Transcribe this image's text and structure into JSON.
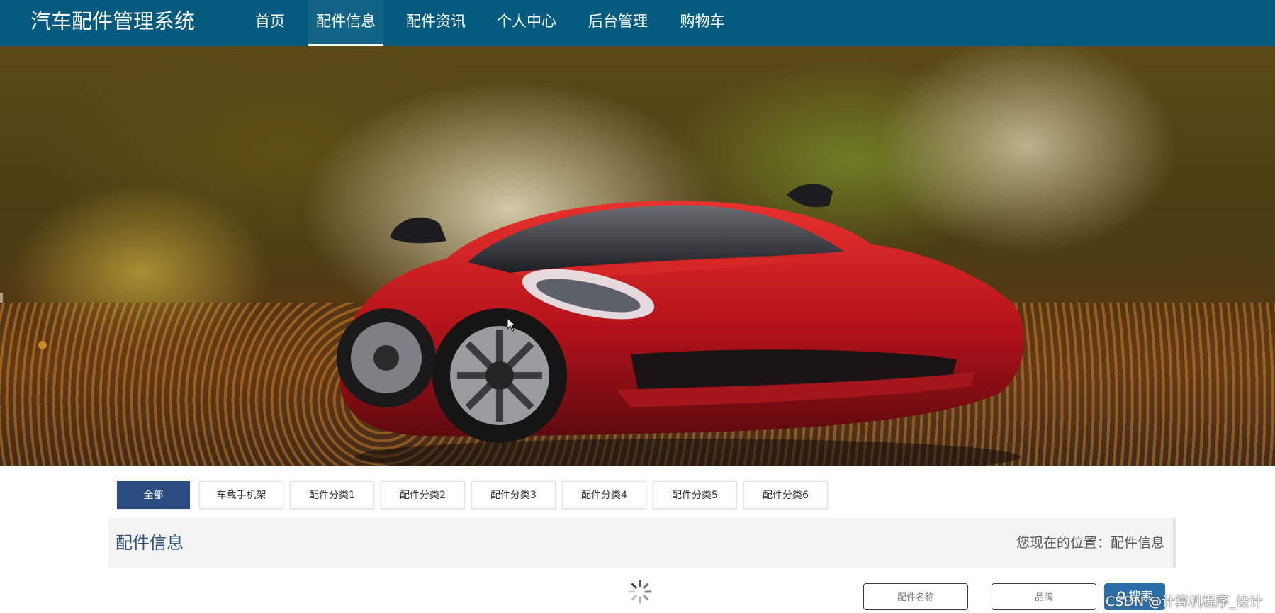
{
  "app": {
    "title": "汽车配件管理系统"
  },
  "nav": {
    "items": [
      {
        "label": "首页",
        "active": false
      },
      {
        "label": "配件信息",
        "active": true
      },
      {
        "label": "配件资讯",
        "active": false
      },
      {
        "label": "个人中心",
        "active": false
      },
      {
        "label": "后台管理",
        "active": false
      },
      {
        "label": "购物车",
        "active": false
      }
    ]
  },
  "banner": {
    "slide_count": 3,
    "active_slide": 1
  },
  "categories": {
    "items": [
      {
        "label": "全部",
        "active": true
      },
      {
        "label": "车载手机架",
        "active": false
      },
      {
        "label": "配件分类1",
        "active": false
      },
      {
        "label": "配件分类2",
        "active": false
      },
      {
        "label": "配件分类3",
        "active": false
      },
      {
        "label": "配件分类4",
        "active": false
      },
      {
        "label": "配件分类5",
        "active": false
      },
      {
        "label": "配件分类6",
        "active": false
      }
    ]
  },
  "section": {
    "title": "配件信息",
    "breadcrumb": "您现在的位置：配件信息"
  },
  "search": {
    "name_placeholder": "配件名称",
    "brand_placeholder": "品牌",
    "button_label": "搜索",
    "icon": "search-icon"
  },
  "watermark": "CSDN @计算机程序_设计",
  "colors": {
    "nav_bg": "#055a80",
    "active_tab": "#2b4c7e",
    "search_button": "#2b6fa8"
  }
}
